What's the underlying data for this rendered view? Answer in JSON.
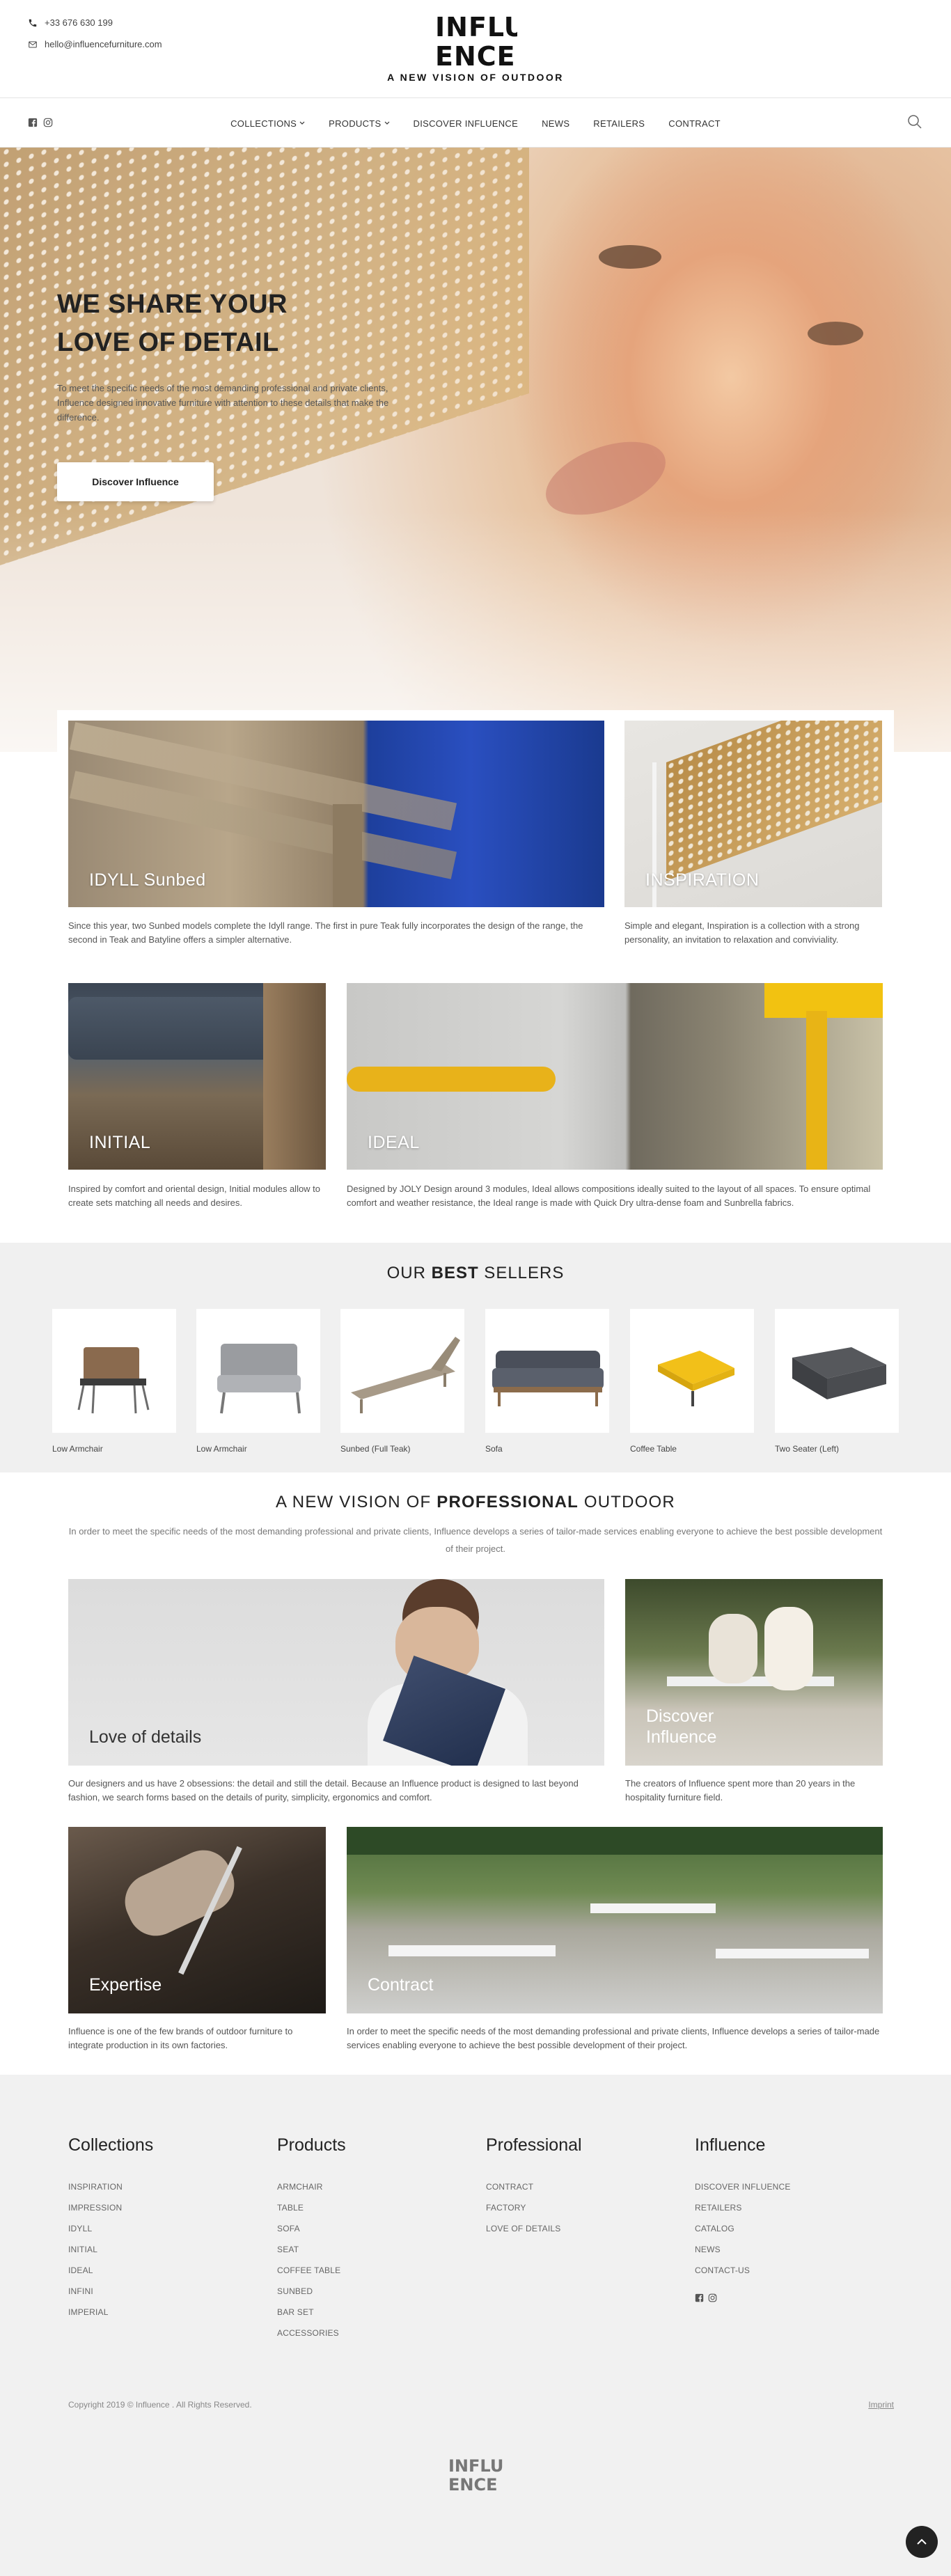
{
  "header": {
    "phone": "+33 676 630 199",
    "email": "hello@influencefurniture.com",
    "logo_line1": "INFLU",
    "logo_line2": "ENCE",
    "tagline": "A NEW VISION OF OUTDOOR"
  },
  "nav": {
    "items": [
      {
        "label": "COLLECTIONS",
        "dropdown": true
      },
      {
        "label": "PRODUCTS",
        "dropdown": true
      },
      {
        "label": "DISCOVER INFLUENCE",
        "dropdown": false
      },
      {
        "label": "NEWS",
        "dropdown": false
      },
      {
        "label": "RETAILERS",
        "dropdown": false
      },
      {
        "label": "CONTRACT",
        "dropdown": false
      }
    ],
    "social_icons": [
      "facebook-icon",
      "instagram-icon"
    ],
    "search_icon": "search-icon"
  },
  "hero": {
    "title_line1": "WE SHARE YOUR",
    "title_line2": "LOVE OF DETAIL",
    "text": "To meet the specific needs of the most demanding professional and private clients, Influence designed innovative furniture with attention to these details that make the difference.",
    "button": "Discover Influence"
  },
  "collections": [
    {
      "label": "IDYLL Sunbed",
      "desc": "Since this year, two Sunbed models complete the Idyll range. The first in pure Teak fully incorporates the design of the range, the second in Teak and Batyline offers a simpler alternative."
    },
    {
      "label": "INSPIRATION",
      "desc": "Simple and elegant, Inspiration is a collection with a strong personality, an invitation to relaxation and conviviality."
    },
    {
      "label": "INITIAL",
      "desc": "Inspired by comfort and oriental design, Initial modules allow to create sets matching all needs and desires."
    },
    {
      "label": "IDEAL",
      "desc": "Designed by JOLY Design around 3 modules, Ideal allows compositions ideally suited to the layout of all spaces. To ensure optimal comfort and weather resistance, the Ideal range is made with Quick Dry ultra-dense foam and Sunbrella fabrics."
    }
  ],
  "best_sellers": {
    "title_pre": "OUR ",
    "title_bold": "BEST",
    "title_post": " SELLERS",
    "products": [
      {
        "name": "Low Armchair"
      },
      {
        "name": "Low Armchair"
      },
      {
        "name": "Sunbed (Full Teak)"
      },
      {
        "name": "Sofa"
      },
      {
        "name": "Coffee Table"
      },
      {
        "name": "Two Seater (Left)"
      }
    ]
  },
  "professional": {
    "title_pre": "A NEW VISION OF ",
    "title_bold": "PROFESSIONAL",
    "title_post": " OUTDOOR",
    "text": "In order to meet the specific needs of the most demanding professional and private clients, Influence develops a series of tailor-made services enabling everyone to achieve the best possible development of their project.",
    "cards": [
      {
        "label": "Love of details",
        "desc": "Our designers and us have 2 obsessions: the detail and still the detail. Because an Influence product is designed to last beyond fashion, we search forms based on the details of purity, simplicity, ergonomics and comfort."
      },
      {
        "label_line1": "Discover",
        "label_line2": "Influence",
        "desc": "The creators of Influence spent more than 20 years in the hospitality furniture field."
      },
      {
        "label": "Expertise",
        "desc": "Influence is one of the few brands of outdoor furniture to integrate production in its own factories."
      },
      {
        "label": "Contract",
        "desc": "In order to meet the specific needs of the most demanding professional and private clients, Influence develops a series of tailor-made services enabling everyone to achieve the best possible development of their project."
      }
    ]
  },
  "footer": {
    "columns": [
      {
        "title": "Collections",
        "items": [
          "INSPIRATION",
          "IMPRESSION",
          "IDYLL",
          "INITIAL",
          "IDEAL",
          "INFINI",
          "IMPERIAL"
        ]
      },
      {
        "title": "Products",
        "items": [
          "ARMCHAIR",
          "TABLE",
          "SOFA",
          "SEAT",
          "COFFEE TABLE",
          "SUNBED",
          "BAR SET",
          "ACCESSORIES"
        ]
      },
      {
        "title": "Professional",
        "items": [
          "CONTRACT",
          "FACTORY",
          "LOVE OF DETAILS"
        ]
      },
      {
        "title": "Influence",
        "items": [
          "DISCOVER INFLUENCE",
          "RETAILERS",
          "CATALOG",
          "NEWS",
          "CONTACT-US"
        ]
      }
    ],
    "copyright": "Copyright 2019 © Influence . All Rights Reserved.",
    "imprint": "Imprint",
    "logo_line1": "INFLU",
    "logo_line2": "ENCE"
  },
  "colors": {
    "accent": "#222222",
    "footer_bg": "#f1f1f1",
    "best_bg": "#f0f0f0"
  }
}
